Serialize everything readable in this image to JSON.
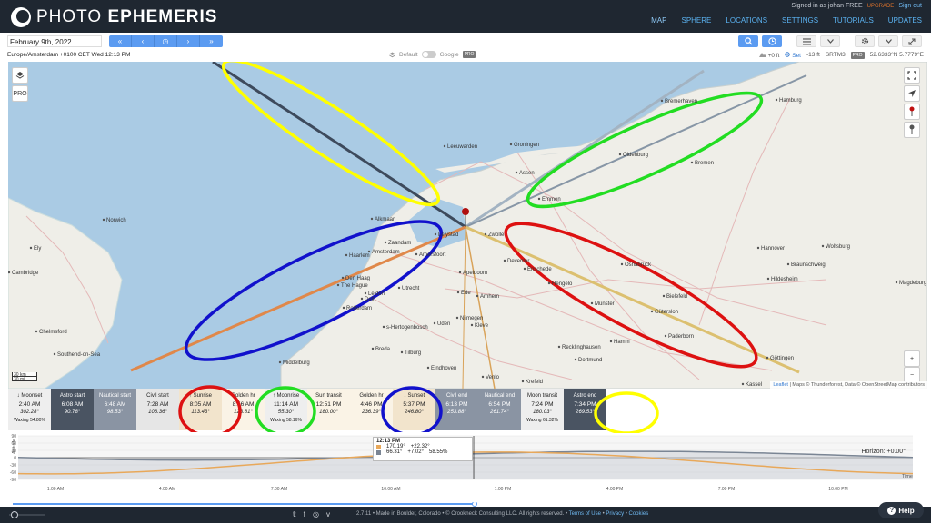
{
  "header": {
    "logo_light": "PHOTO",
    "logo_bold": "EPHEMERIS",
    "signed_in": "Signed in as johan FREE",
    "upgrade": "UPGRADE",
    "sign_out": "Sign out",
    "nav": [
      "MAP",
      "SPHERE",
      "LOCATIONS",
      "SETTINGS",
      "TUTORIALS",
      "UPDATES"
    ]
  },
  "toolbar": {
    "date": "February 9th, 2022",
    "nav_buttons": [
      "«",
      "‹",
      "◷",
      "›",
      "»"
    ]
  },
  "info": {
    "timezone": "Europe/Amsterdam +0100 CET Wed 12:13 PM",
    "layer_default": "Default",
    "layer_google": "Google",
    "pro": "PRO",
    "height": "+0 ft",
    "set": "Set",
    "elev": "-13 ft",
    "srtm": "SRTM3",
    "coords": "52.6333°N 5.7779°E"
  },
  "map": {
    "pro_badge": "PRO",
    "scale_km": "30 km",
    "scale_mi": "30 mi",
    "attrib_leaflet": "Leaflet",
    "attrib_rest": " | Maps © Thunderforest, Data © OpenStreetMap contributors",
    "cities": [
      {
        "n": "Hamburg"
      },
      {
        "n": "Bremerhaven"
      },
      {
        "n": "Groningen"
      },
      {
        "n": "Leeuwarden"
      },
      {
        "n": "Oldenburg"
      },
      {
        "n": "Bremen"
      },
      {
        "n": "Assen"
      },
      {
        "n": "Emmen"
      },
      {
        "n": "Alkmaar"
      },
      {
        "n": "Amsterdam"
      },
      {
        "n": "Zwolle"
      },
      {
        "n": "Lelystad"
      },
      {
        "n": "Haarlem"
      },
      {
        "n": "Amersfoort"
      },
      {
        "n": "Apeldoorn"
      },
      {
        "n": "Den Haag"
      },
      {
        "n": "The Hague"
      },
      {
        "n": "Utrecht"
      },
      {
        "n": "Ede"
      },
      {
        "n": "Arnhem"
      },
      {
        "n": "Enschede"
      },
      {
        "n": "Rotterdam"
      },
      {
        "n": "Nijmegen"
      },
      {
        "n": "Kleve"
      },
      {
        "n": "Münster"
      },
      {
        "n": "Osnabrück"
      },
      {
        "n": "Bielefeld"
      },
      {
        "n": "Gütersloh"
      },
      {
        "n": "Paderborn"
      },
      {
        "n": "Hannover"
      },
      {
        "n": "Braunschweig"
      },
      {
        "n": "Hildesheim"
      },
      {
        "n": "Wolfsburg"
      },
      {
        "n": "Magdeburg"
      },
      {
        "n": "Göttingen"
      },
      {
        "n": "Kassel"
      },
      {
        "n": "Dortmund"
      },
      {
        "n": "Hamm"
      },
      {
        "n": "Recklinghausen"
      },
      {
        "n": "Breda"
      },
      {
        "n": "Tilburg"
      },
      {
        "n": "Eindhoven"
      },
      {
        "n": "Middelburg"
      },
      {
        "n": "Norwich"
      },
      {
        "n": "Ely"
      },
      {
        "n": "Cambridge"
      },
      {
        "n": "Chelmsford"
      },
      {
        "n": "Southend-on-Sea"
      },
      {
        "n": "Krefeld"
      },
      {
        "n": "Venlo"
      },
      {
        "n": "Uden"
      },
      {
        "n": "s-Hertogenbosch"
      },
      {
        "n": "Leiden"
      },
      {
        "n": "Delft"
      },
      {
        "n": "Zaandam"
      },
      {
        "n": "Deventer"
      },
      {
        "n": "Hengelo"
      }
    ]
  },
  "events": [
    {
      "label": "↓ Moonset",
      "time": "2:40 AM",
      "az": "302.28°",
      "extra": "Waxing 54.80%",
      "style": "light"
    },
    {
      "label": "Astro start",
      "time": "6:08 AM",
      "az": "90.78°",
      "extra": "",
      "style": "dark"
    },
    {
      "label": "Nautical start",
      "time": "6:48 AM",
      "az": "98.53°",
      "extra": "",
      "style": "mid"
    },
    {
      "label": "Civil start",
      "time": "7:28 AM",
      "az": "106.36°",
      "extra": "",
      "style": "moon"
    },
    {
      "label": "↑ Sunrise",
      "time": "8:05 AM",
      "az": "113.43°",
      "extra": "",
      "style": "lightsun"
    },
    {
      "label": "Golden hr",
      "time": "8:56 AM",
      "az": "123.81°",
      "extra": "",
      "style": "day"
    },
    {
      "label": "↑ Moonrise",
      "time": "11:14 AM",
      "az": "55.30°",
      "extra": "Waxing 58.16%",
      "style": "light"
    },
    {
      "label": "Sun transit",
      "time": "12:51 PM",
      "az": "180.00°",
      "extra": "",
      "style": "day"
    },
    {
      "label": "Golden hr",
      "time": "4:46 PM",
      "az": "236.39°",
      "extra": "",
      "style": "day"
    },
    {
      "label": "↓ Sunset",
      "time": "5:37 PM",
      "az": "246.80°",
      "extra": "",
      "style": "lightsun"
    },
    {
      "label": "Civil end",
      "time": "6:13 PM",
      "az": "253.88°",
      "extra": "",
      "style": "mid"
    },
    {
      "label": "Nautical end",
      "time": "6:54 PM",
      "az": "261.74°",
      "extra": "",
      "style": "mid"
    },
    {
      "label": "Moon transit",
      "time": "7:24 PM",
      "az": "180.03°",
      "extra": "Waxing 61.32%",
      "style": "light"
    },
    {
      "label": "Astro end",
      "time": "7:34 PM",
      "az": "269.53°",
      "extra": "",
      "style": "dark"
    }
  ],
  "chart": {
    "popup_time": "12:13 PM",
    "sun_row": [
      "170.19°",
      "+22.32°"
    ],
    "moon_row": [
      "66.31°",
      "+7.02°",
      "58.55%"
    ],
    "horizon": "Horizon: +0.00°",
    "time_label": "Time",
    "alt_label": "Altitude",
    "y_ticks": [
      "90",
      "60",
      "30",
      "0",
      "-30",
      "-60",
      "-90"
    ],
    "x_ticks": [
      "1:00 AM",
      "4:00 AM",
      "7:00 AM",
      "10:00 AM",
      "1:00 PM",
      "4:00 PM",
      "7:00 PM",
      "10:00 PM"
    ],
    "sun_color": "#e8a85a",
    "moon_color": "#7a8594"
  },
  "footer": {
    "text": "2.7.11 • Made in Boulder, Colorado • © Crookneck Consulting LLC. All rights reserved. • ",
    "terms": "Terms of Use",
    "privacy": "Privacy",
    "cookies": "Cookies",
    "help": "Help"
  },
  "colors": {
    "header_bg": "#1f2731",
    "accent": "#5b9bf1",
    "annotation_yellow": "#ffff00",
    "annotation_green": "#22dd22",
    "annotation_blue": "#1111cc",
    "annotation_red": "#dd1111"
  }
}
